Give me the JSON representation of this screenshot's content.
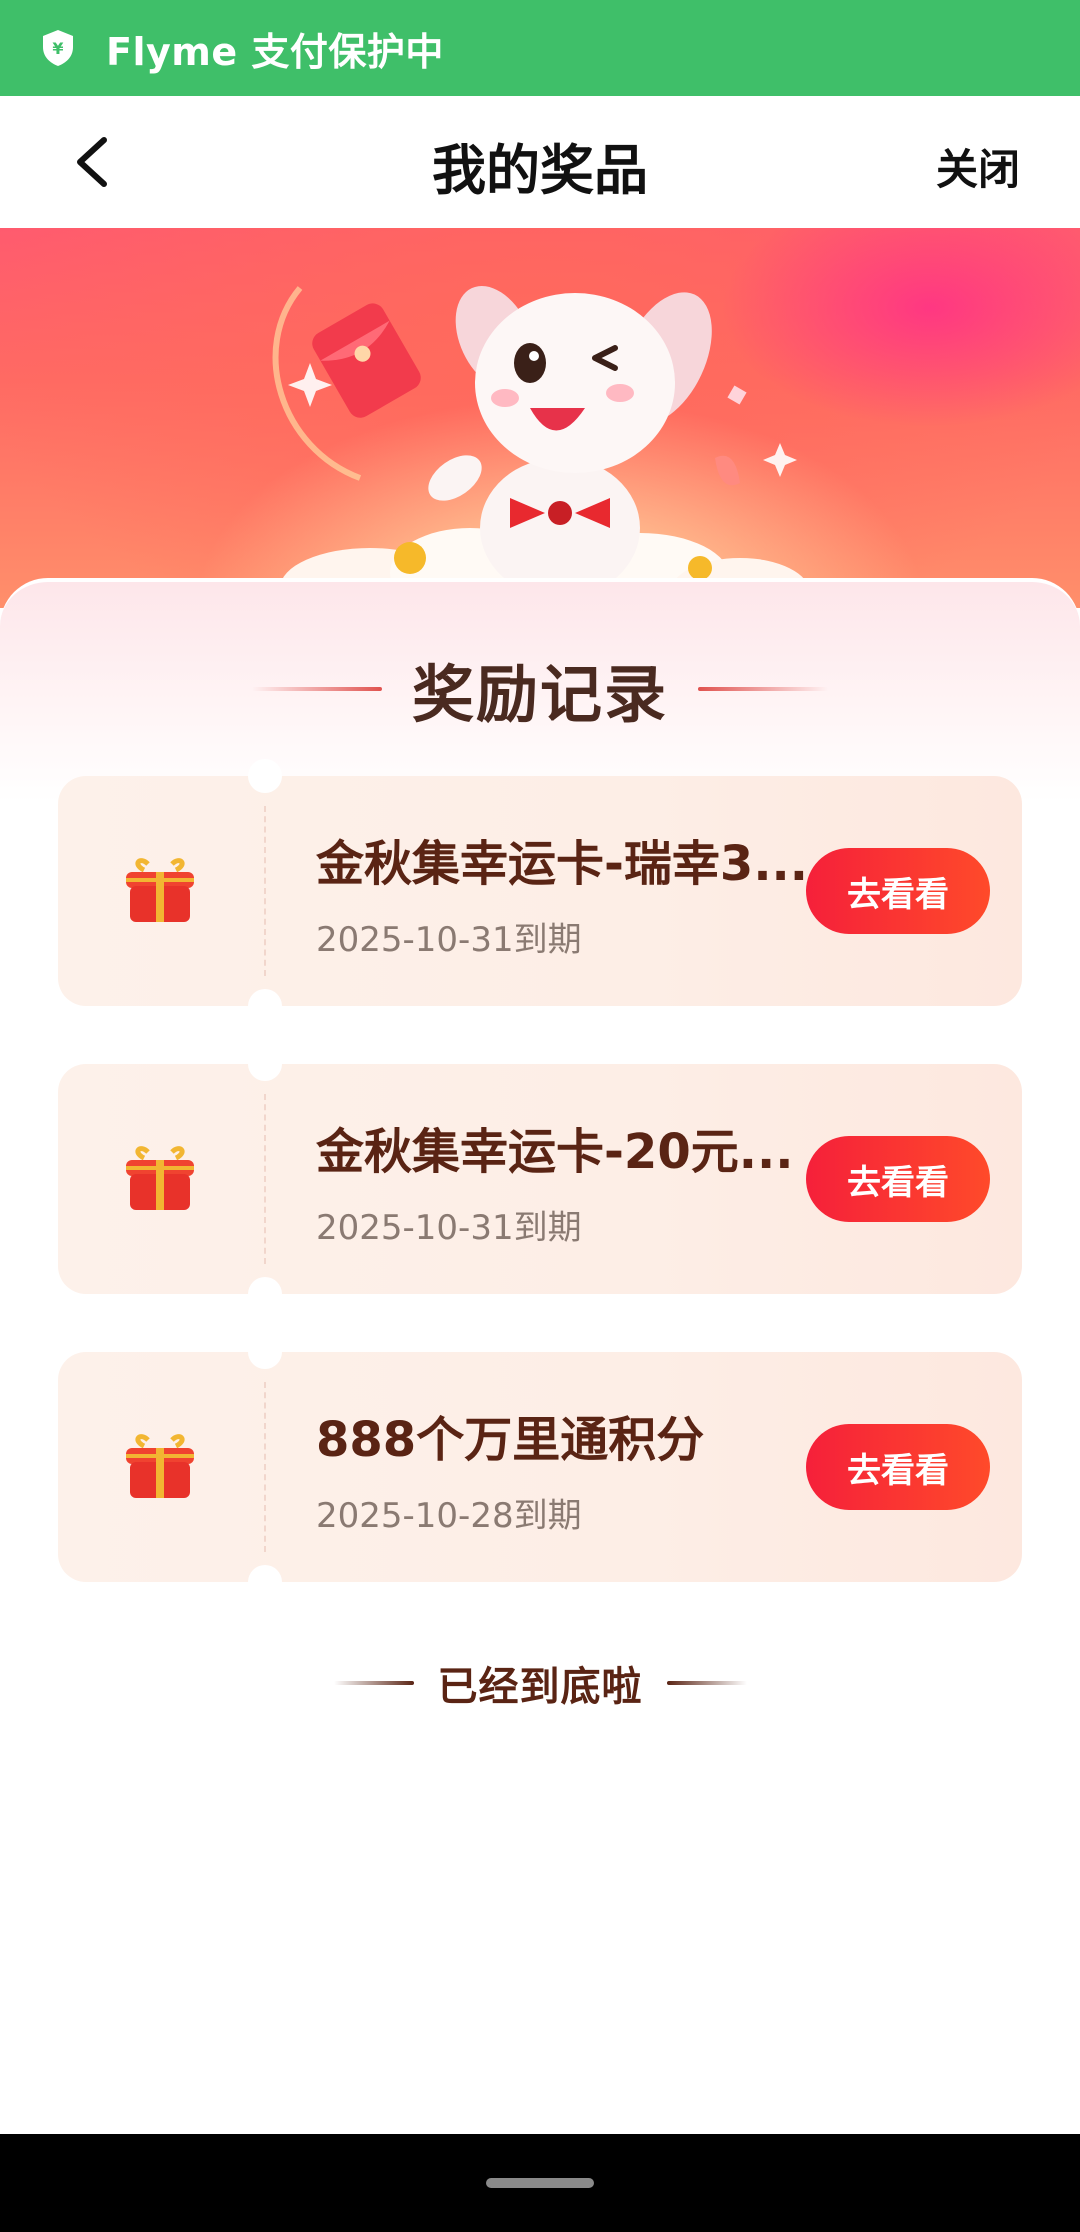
{
  "status_bar": {
    "text": "Flyme 支付保护中",
    "color": "#3fbf69"
  },
  "titlebar": {
    "title": "我的奖品",
    "close_label": "关闭",
    "back_icon": "chevron-left-icon"
  },
  "section": {
    "title": "奖励记录"
  },
  "rewards": [
    {
      "name": "金秋集幸运卡-瑞幸3...",
      "expire": "2025-10-31到期",
      "button": "去看看",
      "icon": "gift-box-icon"
    },
    {
      "name": "金秋集幸运卡-20元...",
      "expire": "2025-10-31到期",
      "button": "去看看",
      "icon": "gift-box-icon"
    },
    {
      "name": "888个万里通积分",
      "expire": "2025-10-28到期",
      "button": "去看看",
      "icon": "gift-box-icon"
    }
  ],
  "footer_note": "已经到底啦",
  "colors": {
    "accent_button": "#f5203a",
    "title_brown": "#5a2414"
  }
}
